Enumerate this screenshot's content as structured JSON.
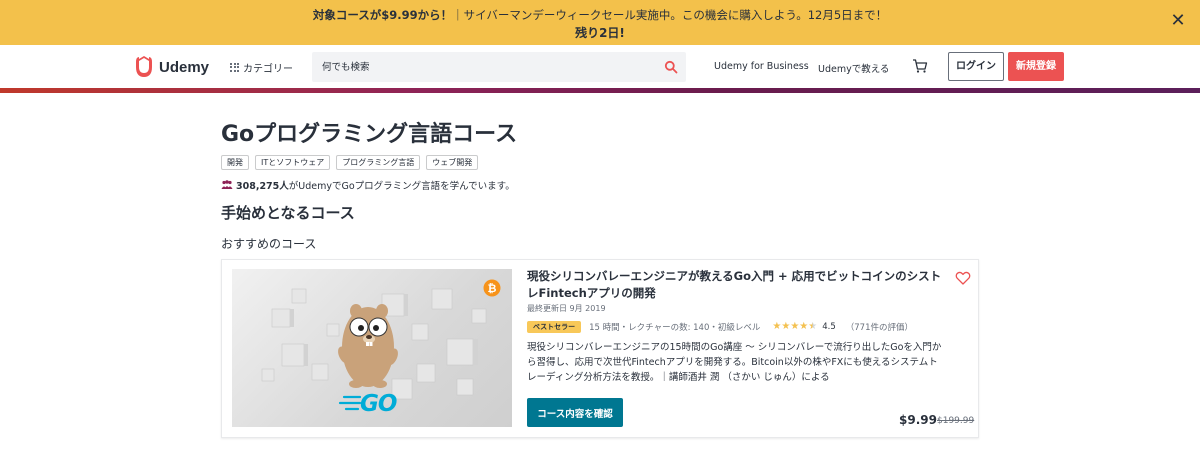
{
  "promo": {
    "line1_bold": "対象コースが$9.99から！",
    "line1_rest": "｜サイバーマンデーウィークセール実施中。この機会に購入しよう。12月5日まで！",
    "line2": "残り2日!",
    "close_symbol": "✕"
  },
  "header": {
    "logo_text": "Udemy",
    "category_label": "カテゴリー",
    "search_placeholder": "何でも検索",
    "business_link": "Udemy for Business",
    "teach_link": "Udemyで教える",
    "login_label": "ログイン",
    "signup_label": "新規登録"
  },
  "page": {
    "title": "Goプログラミング言語コース",
    "tags": [
      "開発",
      "ITとソフトウェア",
      "プログラミング言語",
      "ウェブ開発"
    ],
    "learners_count": "308,275人",
    "learners_rest": "がUdemyでGoプログラミング言語を学んでいます。",
    "section_title": "手始めとなるコース",
    "recommended_label": "おすすめのコース"
  },
  "course": {
    "title": "現役シリコンバレーエンジニアが教えるGo入門 + 応用でビットコインのシストレFintechアプリの開発",
    "updated": "最終更新日 9月 2019",
    "badge": "ベストセラー",
    "meta": "15 時間・レクチャーの数: 140・初級レベル",
    "rating_value": "4.5",
    "rating_fraction": 0.9,
    "reviews": "（771件の評価）",
    "description": "現役シリコンバレーエンジニアの15時間のGo講座 〜 シリコンバレーで流行り出したGoを入門から習得し、応用で次世代Fintechアプリを開発する。Bitcoin以外の株やFXにも使えるシステムトレーディング分析方法を教授。｜講師酒井 潤 （さかい じゅん）による",
    "cta_label": "コース内容を確認",
    "price": "$9.99",
    "original_price": "$199.99",
    "thumb_logo_text": "GO"
  },
  "colors": {
    "promo_bg": "#f3c14b",
    "brand_red": "#ec5252",
    "cta_teal": "#007791",
    "bitcoin_orange": "#f7931a",
    "go_teal": "#00acd7"
  }
}
